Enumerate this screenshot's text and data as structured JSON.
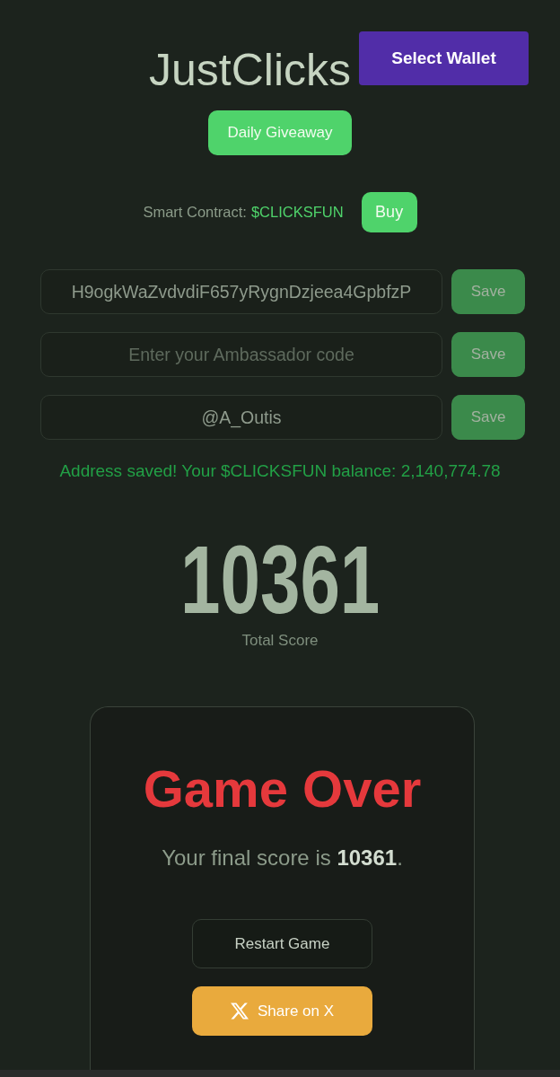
{
  "header": {
    "title": "JustClicks",
    "wallet_button": "Select Wallet"
  },
  "giveaway_button": "Daily Giveaway",
  "contract": {
    "label": "Smart Contract:",
    "token": "$CLICKSFUN",
    "buy_button": "Buy"
  },
  "fields": [
    {
      "value": "H9ogkWaZvdvdiF657yRygnDzjeea4GpbfzP",
      "button": "Save"
    },
    {
      "placeholder": "Enter your Ambassador code",
      "button": "Save"
    },
    {
      "value": "@A_Outis",
      "button": "Save"
    }
  ],
  "status_message": "Address saved! Your $CLICKSFUN balance: 2,140,774.78",
  "score": {
    "value": "10361",
    "label": "Total Score"
  },
  "game_over": {
    "title": "Game Over",
    "message": "Your final score is **10361**.",
    "restart_button": "Restart Game",
    "share_button": "Share on X"
  }
}
